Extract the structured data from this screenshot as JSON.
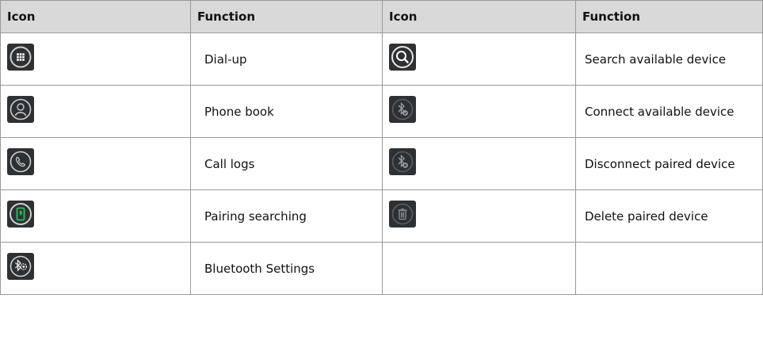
{
  "table": {
    "headers": [
      "Icon",
      "Function",
      "Icon",
      "Function"
    ],
    "rows": [
      {
        "left": {
          "icon": "dialpad-icon",
          "function": "Dial-up"
        },
        "right": {
          "icon": "search-icon",
          "function": "Search available device"
        }
      },
      {
        "left": {
          "icon": "phonebook-contact-icon",
          "function": "Phone book"
        },
        "right": {
          "icon": "bluetooth-connect-icon",
          "function": "Connect available device"
        }
      },
      {
        "left": {
          "icon": "call-log-phone-icon",
          "function": "Call logs"
        },
        "right": {
          "icon": "bluetooth-disconnect-icon",
          "function": "Disconnect paired device"
        }
      },
      {
        "left": {
          "icon": "pairing-search-phone-icon",
          "function": "Pairing searching"
        },
        "right": {
          "icon": "delete-trash-icon",
          "function": "Delete paired device"
        }
      },
      {
        "left": {
          "icon": "bluetooth-settings-icon",
          "function": "Bluetooth Settings"
        },
        "right": {
          "icon": "",
          "function": ""
        }
      }
    ]
  },
  "colors": {
    "header_bg": "#d9d9d9",
    "icon_bg": "#2e3134",
    "icon_ring": "#cfcfcf",
    "accent_green": "#22c55e"
  }
}
